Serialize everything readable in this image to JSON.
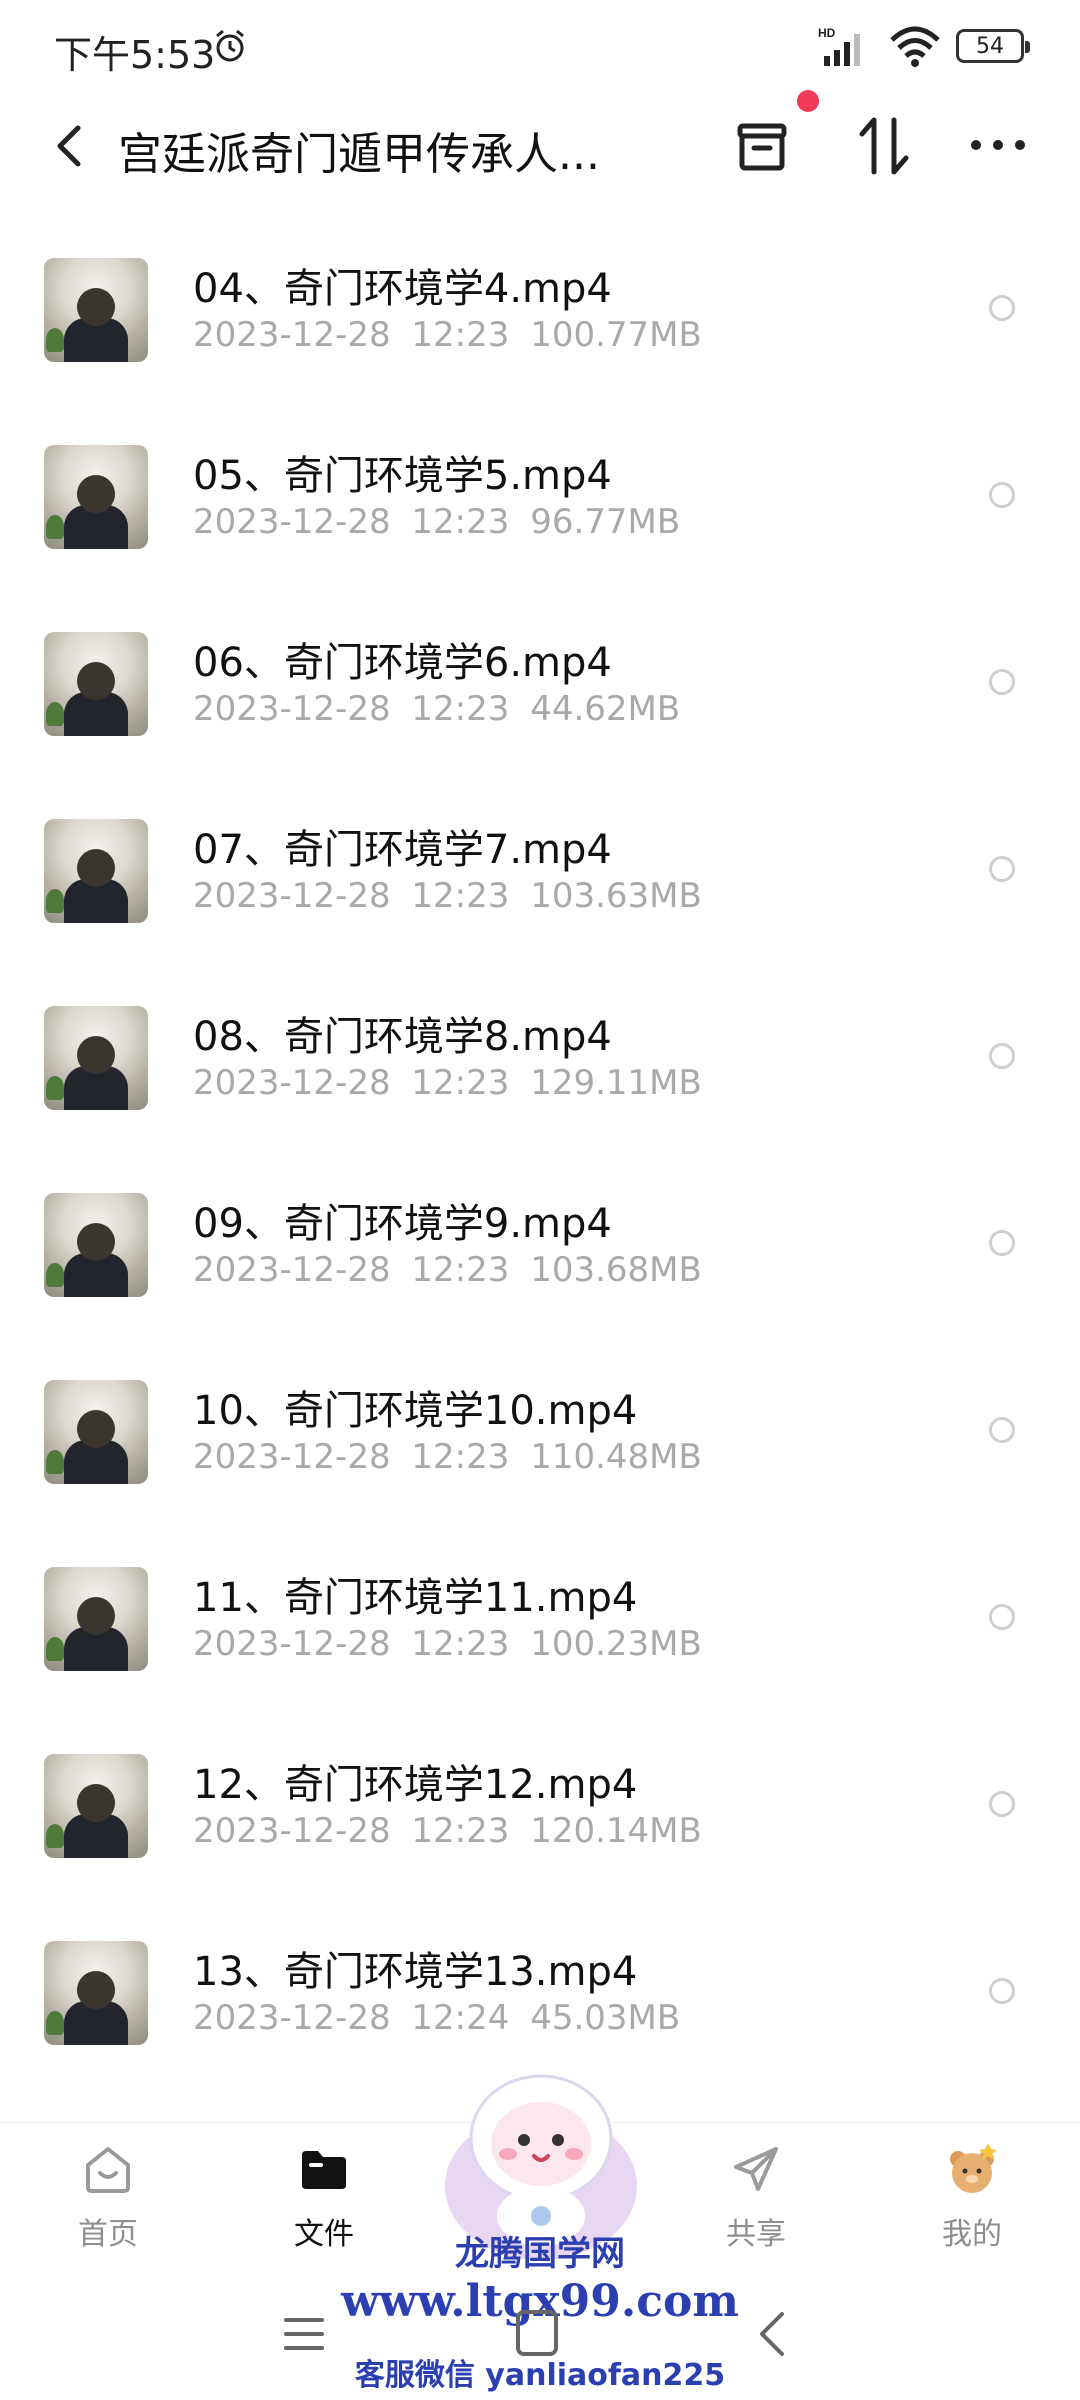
{
  "status_bar": {
    "time": "下午5:53",
    "network": "HD",
    "battery": "54"
  },
  "header": {
    "title": "宫廷派奇门遁甲传承人..."
  },
  "files": [
    {
      "name": "04、奇门环境学4.mp4",
      "date": "2023-12-28",
      "time": "12:23",
      "size": "100.77MB"
    },
    {
      "name": "05、奇门环境学5.mp4",
      "date": "2023-12-28",
      "time": "12:23",
      "size": "96.77MB"
    },
    {
      "name": "06、奇门环境学6.mp4",
      "date": "2023-12-28",
      "time": "12:23",
      "size": "44.62MB"
    },
    {
      "name": "07、奇门环境学7.mp4",
      "date": "2023-12-28",
      "time": "12:23",
      "size": "103.63MB"
    },
    {
      "name": "08、奇门环境学8.mp4",
      "date": "2023-12-28",
      "time": "12:23",
      "size": "129.11MB"
    },
    {
      "name": "09、奇门环境学9.mp4",
      "date": "2023-12-28",
      "time": "12:23",
      "size": "103.68MB"
    },
    {
      "name": "10、奇门环境学10.mp4",
      "date": "2023-12-28",
      "time": "12:23",
      "size": "110.48MB"
    },
    {
      "name": "11、奇门环境学11.mp4",
      "date": "2023-12-28",
      "time": "12:23",
      "size": "100.23MB"
    },
    {
      "name": "12、奇门环境学12.mp4",
      "date": "2023-12-28",
      "time": "12:23",
      "size": "120.14MB"
    },
    {
      "name": "13、奇门环境学13.mp4",
      "date": "2023-12-28",
      "time": "12:24",
      "size": "45.03MB"
    }
  ],
  "bottom_nav": {
    "items": [
      {
        "label": "首页",
        "icon": "home-icon",
        "active": false
      },
      {
        "label": "文件",
        "icon": "folder-icon",
        "active": true
      },
      {
        "label": "共享",
        "icon": "share-icon",
        "active": false
      },
      {
        "label": "我的",
        "icon": "profile-bear-icon",
        "active": false
      }
    ]
  },
  "watermark": {
    "line1": "龙腾国学网",
    "line2": "www.ltgx99.com",
    "line3": "客服微信 yanliaofan225"
  },
  "colors": {
    "notification_dot": "#f03a5a",
    "watermark": "#2c3fb0",
    "meta_text": "#a9a9a9"
  }
}
